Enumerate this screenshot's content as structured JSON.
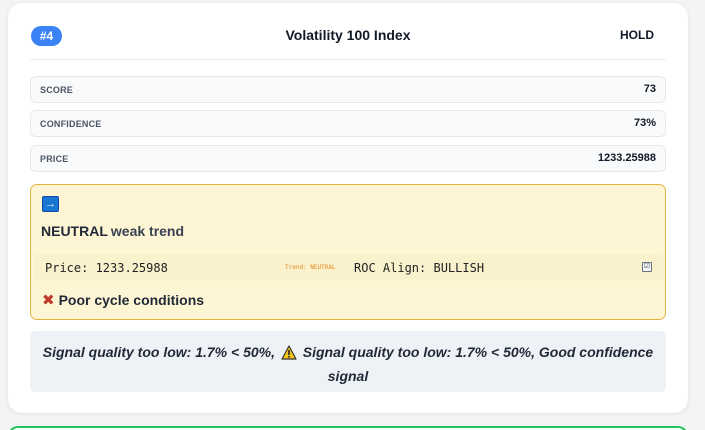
{
  "card": {
    "rank": "#4",
    "title": "Volatility 100 Index",
    "action": "HOLD"
  },
  "metrics": [
    {
      "label": "SCORE",
      "value": "73"
    },
    {
      "label": "CONFIDENCE",
      "value": "73%"
    },
    {
      "label": "PRICE",
      "value": "1233.25988"
    }
  ],
  "signal": {
    "icon": "right-arrow-icon",
    "direction": "NEUTRAL",
    "strength": "weak trend",
    "price_text": "Price: 1233.25988",
    "trend_text": "Trend: NEUTRAL",
    "roc_text": "ROC Align: BULLISH",
    "cycle_text": "Poor cycle conditions"
  },
  "note": {
    "part1": "Signal quality too low: 1.7% < 50%,",
    "part2": "Signal quality too low: 1.7% < 50%, Good confidence signal"
  },
  "colors": {
    "badge": "#3b82f6",
    "signal_bg": "#fdf5d4",
    "signal_border": "#e0b640",
    "next_card_border": "#22c55e"
  }
}
